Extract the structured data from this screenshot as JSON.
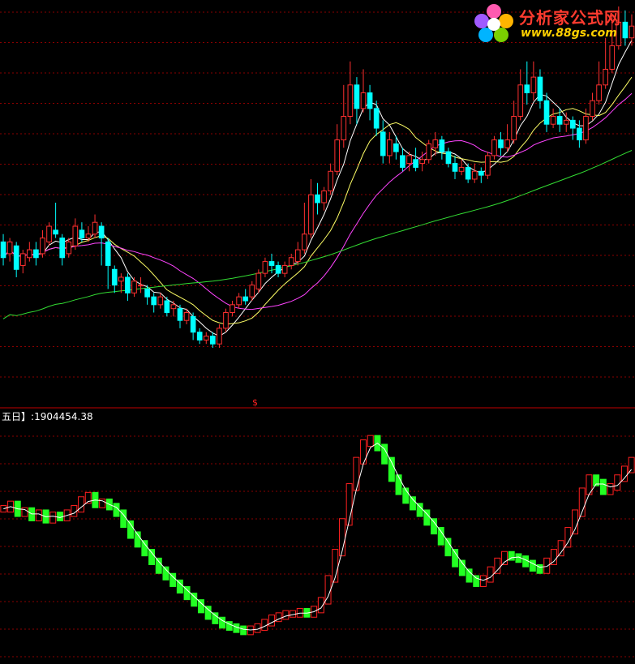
{
  "logo": {
    "title": "分析家公式网",
    "url": "www.88gs.com"
  },
  "indicator": {
    "name": "五日】",
    "separator": ":",
    "value": "1904454.38"
  },
  "panel_marker": "$",
  "colors": {
    "background": "#000000",
    "grid": "#8a0000",
    "divider": "#c00000",
    "up": "#ff3030",
    "down": "#00ffff",
    "ma5": "#ffffff",
    "ma10": "#ffff66",
    "ma20": "#ff44ff",
    "ma60": "#33dd33",
    "bar_up": "#ff2020",
    "bar_down": "#22ff22",
    "indicator_line": "#ffffff"
  },
  "chart_data": [
    {
      "type": "candlestick",
      "panel": "price",
      "ylim": [
        0,
        100
      ],
      "candles": [
        [
          40,
          36,
          42,
          34
        ],
        [
          37,
          40,
          41,
          35
        ],
        [
          39,
          33,
          40,
          31
        ],
        [
          34,
          37,
          38,
          32
        ],
        [
          36,
          38,
          40,
          35
        ],
        [
          38,
          36,
          40,
          34
        ],
        [
          37,
          41,
          43,
          36
        ],
        [
          40,
          44,
          45,
          39
        ],
        [
          43,
          42,
          50,
          41
        ],
        [
          41,
          36,
          42,
          34
        ],
        [
          37,
          40,
          41,
          36
        ],
        [
          39,
          44,
          46,
          38
        ],
        [
          43,
          41,
          45,
          40
        ],
        [
          41,
          42,
          44,
          40
        ],
        [
          42,
          45,
          47,
          41
        ],
        [
          44,
          41,
          45,
          34
        ],
        [
          40,
          34,
          41,
          28
        ],
        [
          33,
          29,
          34,
          27
        ],
        [
          30,
          31,
          32,
          27
        ],
        [
          31,
          27,
          32,
          25
        ],
        [
          27,
          30,
          31,
          26
        ],
        [
          29,
          29,
          31,
          27
        ],
        [
          28,
          26,
          29,
          24
        ],
        [
          26,
          24,
          27,
          22
        ],
        [
          24,
          26,
          27,
          23
        ],
        [
          25,
          22,
          26,
          21
        ],
        [
          23,
          24,
          25,
          21
        ],
        [
          23,
          20,
          24,
          18
        ],
        [
          20,
          22,
          23,
          19
        ],
        [
          21,
          17,
          22,
          15
        ],
        [
          17,
          15,
          18,
          14
        ],
        [
          15,
          16,
          17,
          14
        ],
        [
          16,
          14,
          17,
          13
        ],
        [
          14,
          18,
          19,
          13
        ],
        [
          18,
          22,
          23,
          17
        ],
        [
          22,
          24,
          25,
          21
        ],
        [
          24,
          26,
          27,
          23
        ],
        [
          26,
          25,
          28,
          24
        ],
        [
          26,
          29,
          30,
          25
        ],
        [
          28,
          32,
          33,
          27
        ],
        [
          32,
          35,
          36,
          31
        ],
        [
          35,
          34,
          37,
          32
        ],
        [
          34,
          32,
          35,
          31
        ],
        [
          32,
          34,
          35,
          31
        ],
        [
          34,
          36,
          37,
          33
        ],
        [
          35,
          38,
          40,
          34
        ],
        [
          38,
          42,
          50,
          37
        ],
        [
          42,
          52,
          56,
          41
        ],
        [
          52,
          50,
          55,
          47
        ],
        [
          50,
          53,
          54,
          48
        ],
        [
          53,
          58,
          60,
          52
        ],
        [
          58,
          66,
          70,
          57
        ],
        [
          66,
          72,
          80,
          64
        ],
        [
          72,
          80,
          86,
          70
        ],
        [
          80,
          74,
          82,
          70
        ],
        [
          74,
          78,
          84,
          73
        ],
        [
          78,
          74,
          80,
          71
        ],
        [
          74,
          69,
          76,
          67
        ],
        [
          68,
          62,
          71,
          60
        ],
        [
          62,
          66,
          68,
          60
        ],
        [
          65,
          63,
          67,
          61
        ],
        [
          62,
          59,
          64,
          58
        ],
        [
          60,
          62,
          63,
          58
        ],
        [
          61,
          59,
          64,
          58
        ],
        [
          60,
          61,
          63,
          58
        ],
        [
          61,
          65,
          66,
          60
        ],
        [
          64,
          66,
          68,
          62
        ],
        [
          66,
          63,
          67,
          61
        ],
        [
          63,
          60,
          64,
          59
        ],
        [
          60,
          58,
          62,
          56
        ],
        [
          58,
          59,
          61,
          57
        ],
        [
          59,
          56,
          60,
          55
        ],
        [
          56,
          58,
          60,
          55
        ],
        [
          58,
          57,
          59,
          55
        ],
        [
          57,
          62,
          63,
          56
        ],
        [
          62,
          66,
          67,
          61
        ],
        [
          66,
          64,
          68,
          62
        ],
        [
          64,
          66,
          70,
          63
        ],
        [
          66,
          72,
          76,
          65
        ],
        [
          72,
          80,
          84,
          71
        ],
        [
          80,
          78,
          86,
          75
        ],
        [
          78,
          82,
          86,
          76
        ],
        [
          82,
          76,
          84,
          74
        ],
        [
          76,
          70,
          78,
          68
        ],
        [
          70,
          72,
          74,
          69
        ],
        [
          72,
          70,
          74,
          68
        ],
        [
          70,
          71,
          73,
          68
        ],
        [
          71,
          69,
          72,
          66
        ],
        [
          69,
          66,
          71,
          64
        ],
        [
          66,
          72,
          74,
          65
        ],
        [
          72,
          76,
          78,
          71
        ],
        [
          76,
          80,
          86,
          75
        ],
        [
          80,
          84,
          92,
          79
        ],
        [
          84,
          90,
          98,
          83
        ],
        [
          90,
          96,
          100,
          89
        ],
        [
          96,
          92,
          99,
          90
        ],
        [
          92,
          95,
          98,
          90
        ]
      ],
      "ma_periods": [
        5,
        10,
        20,
        60
      ]
    },
    {
      "type": "bar",
      "panel": "indicator",
      "series_name": "五日】",
      "last_value": 1904454.38,
      "ylim": [
        0,
        100
      ],
      "values": [
        62,
        64,
        60,
        61,
        58,
        60,
        57,
        59,
        58,
        60,
        62,
        66,
        68,
        64,
        65,
        63,
        60,
        55,
        50,
        46,
        42,
        38,
        34,
        31,
        28,
        25,
        22,
        19,
        16,
        13,
        11,
        9,
        8,
        7,
        6,
        7,
        8,
        10,
        12,
        13,
        14,
        14,
        15,
        14,
        16,
        20,
        30,
        42,
        56,
        72,
        84,
        92,
        94,
        90,
        84,
        76,
        70,
        66,
        63,
        60,
        56,
        52,
        47,
        42,
        37,
        33,
        30,
        28,
        30,
        34,
        38,
        41,
        40,
        39,
        37,
        35,
        34,
        38,
        42,
        46,
        52,
        60,
        70,
        76,
        74,
        70,
        72,
        76,
        80,
        84
      ]
    }
  ]
}
